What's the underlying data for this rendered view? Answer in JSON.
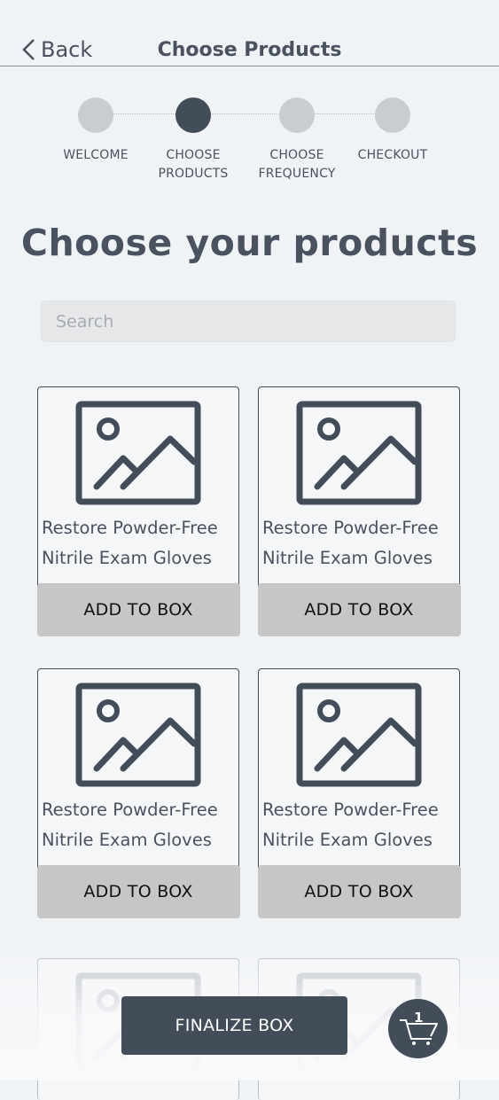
{
  "header": {
    "back_label": "Back",
    "title": "Choose Products"
  },
  "steps": [
    {
      "label": "WELCOME",
      "active": false
    },
    {
      "label": "CHOOSE\nPRODUCTS",
      "active": true
    },
    {
      "label": "CHOOSE\nFREQUENCY",
      "active": false
    },
    {
      "label": "CHECKOUT",
      "active": false
    }
  ],
  "main": {
    "heading": "Choose your products",
    "search_placeholder": "Search"
  },
  "products": [
    {
      "name": "Restore Powder-Free Nitrile Exam Gloves",
      "button": "ADD TO BOX"
    },
    {
      "name": "Restore Powder-Free Nitrile Exam Gloves",
      "button": "ADD TO BOX"
    },
    {
      "name": "Restore Powder-Free Nitrile Exam Gloves",
      "button": "ADD TO BOX"
    },
    {
      "name": "Restore Powder-Free Nitrile Exam Gloves",
      "button": "ADD TO BOX"
    }
  ],
  "footer": {
    "finalize_label": "FINALIZE BOX",
    "cart_count": "1"
  },
  "colors": {
    "primary": "#434c59",
    "step_inactive": "#c9cdd2",
    "button_gray": "#c6c6c6",
    "background": "#f0f3f6"
  }
}
